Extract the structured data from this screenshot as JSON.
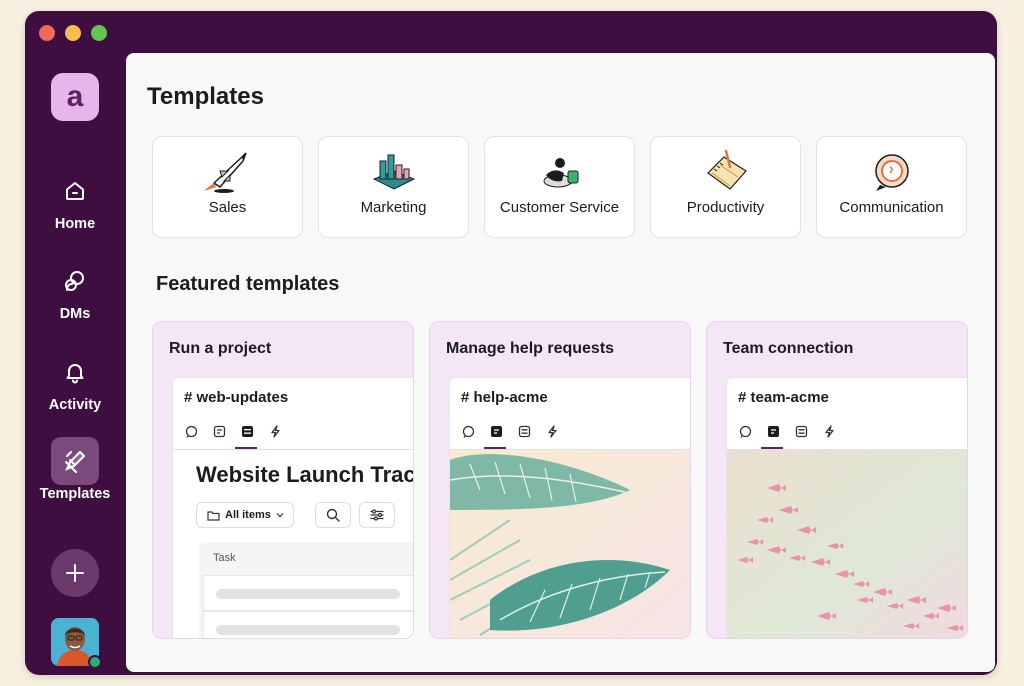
{
  "sidebar": {
    "workspace_initial": "a",
    "items": [
      {
        "label": "Home",
        "icon": "home-icon",
        "active": false
      },
      {
        "label": "DMs",
        "icon": "dms-icon",
        "active": false
      },
      {
        "label": "Activity",
        "icon": "bell-icon",
        "active": false
      },
      {
        "label": "Templates",
        "icon": "templates-icon",
        "active": true
      }
    ],
    "add_icon": "plus-icon",
    "presence_color": "#2bac76"
  },
  "main": {
    "title": "Templates",
    "categories": [
      {
        "label": "Sales",
        "icon": "rocket-illustration"
      },
      {
        "label": "Marketing",
        "icon": "chart-illustration"
      },
      {
        "label": "Customer Service",
        "icon": "support-illustration"
      },
      {
        "label": "Productivity",
        "icon": "notebook-illustration"
      },
      {
        "label": "Communication",
        "icon": "speech-bubble-illustration"
      }
    ],
    "featured_title": "Featured templates",
    "featured": [
      {
        "title": "Run a project",
        "channel": "# web-updates",
        "canvas_title": "Website Launch Tracker",
        "filter_label": "All items",
        "table_header": "Task"
      },
      {
        "title": "Manage help requests",
        "channel": "# help-acme"
      },
      {
        "title": "Team connection",
        "channel": "# team-acme"
      }
    ]
  },
  "colors": {
    "window": "#3f0e40",
    "accent": "#611f69",
    "card_tint": "#f4e5f7"
  }
}
